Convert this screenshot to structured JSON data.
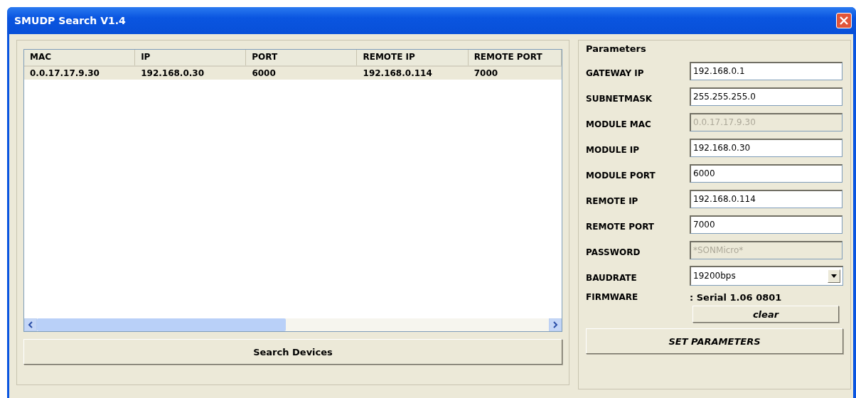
{
  "window": {
    "title": "SMUDP Search V1.4"
  },
  "table": {
    "columns": [
      "MAC",
      "IP",
      "PORT",
      "REMOTE IP",
      "REMOTE PORT"
    ],
    "rows": [
      {
        "cells": [
          "0.0.17.17.9.30",
          "192.168.0.30",
          "6000",
          "192.168.0.114",
          "7000"
        ],
        "selected": true
      }
    ]
  },
  "search_button": "Search Devices",
  "parameters": {
    "title": "Parameters",
    "fields": [
      {
        "kind": "text",
        "label": "GATEWAY IP",
        "value": "192.168.0.1",
        "disabled": false
      },
      {
        "kind": "text",
        "label": "SUBNETMASK",
        "value": "255.255.255.0",
        "disabled": false
      },
      {
        "kind": "text",
        "label": "MODULE MAC",
        "value": "0.0.17.17.9.30",
        "disabled": true
      },
      {
        "kind": "text",
        "label": "MODULE IP",
        "value": "192.168.0.30",
        "disabled": false
      },
      {
        "kind": "text",
        "label": "MODULE PORT",
        "value": "6000",
        "disabled": false
      },
      {
        "kind": "text",
        "label": "REMOTE IP",
        "value": "192.168.0.114",
        "disabled": false
      },
      {
        "kind": "text",
        "label": "REMOTE PORT",
        "value": "7000",
        "disabled": false
      },
      {
        "kind": "text",
        "label": "PASSWORD",
        "value": "*SONMicro*",
        "disabled": true
      },
      {
        "kind": "combo",
        "label": "BAUDRATE",
        "value": "19200bps",
        "disabled": false
      },
      {
        "kind": "info",
        "label": "FIRMWARE",
        "value": ": Serial 1.06 0801"
      }
    ],
    "clear_button": "clear",
    "set_button": "SET PARAMETERS"
  }
}
